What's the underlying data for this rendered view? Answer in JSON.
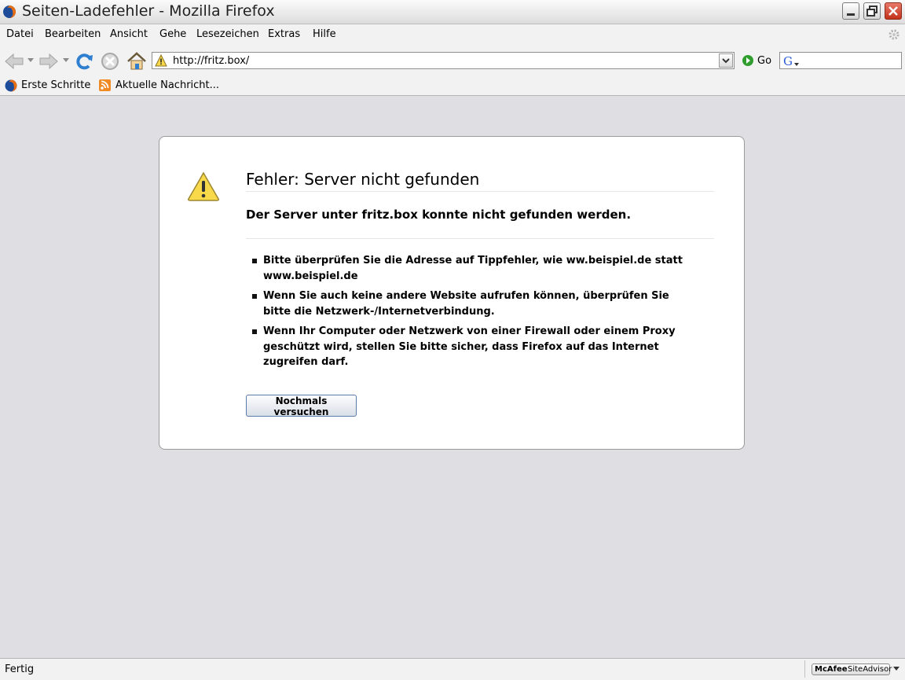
{
  "window": {
    "title": "Seiten-Ladefehler - Mozilla Firefox"
  },
  "menubar": {
    "items": [
      {
        "label": "Datei"
      },
      {
        "label": "Bearbeiten"
      },
      {
        "label": "Ansicht"
      },
      {
        "label": "Gehe"
      },
      {
        "label": "Lesezeichen"
      },
      {
        "label": "Extras"
      },
      {
        "label": "Hilfe"
      }
    ]
  },
  "navbar": {
    "url": "http://fritz.box/",
    "go_label": "Go",
    "search_value": ""
  },
  "bookmarks": [
    {
      "label": "Erste Schritte",
      "icon": "firefox-icon"
    },
    {
      "label": "Aktuelle Nachricht...",
      "icon": "rss-feed-icon"
    }
  ],
  "error": {
    "title": "Fehler: Server nicht gefunden",
    "short_desc": "Der Server unter fritz.box konnte nicht gefunden werden.",
    "items": [
      "Bitte überprüfen Sie die Adresse auf Tippfehler, wie ww.beispiel.de statt www.beispiel.de",
      "Wenn Sie auch keine andere Website aufrufen können, überprüfen Sie bitte die Netzwerk-/Internetverbindung.",
      "Wenn Ihr Computer oder Netzwerk von einer Firewall oder einem Proxy geschützt wird, stellen Sie bitte sicher, dass Firefox auf das Internet zugreifen darf."
    ],
    "retry_label": "Nochmals versuchen"
  },
  "statusbar": {
    "text": "Fertig",
    "siteadvisor_brand": "McAfee",
    "siteadvisor_product": "SiteAdvisor"
  },
  "colors": {
    "content_background": "#dedee3",
    "warning_yellow": "#f7d94a",
    "close_button_red": "#c3311a",
    "go_green": "#2f9e2f"
  }
}
